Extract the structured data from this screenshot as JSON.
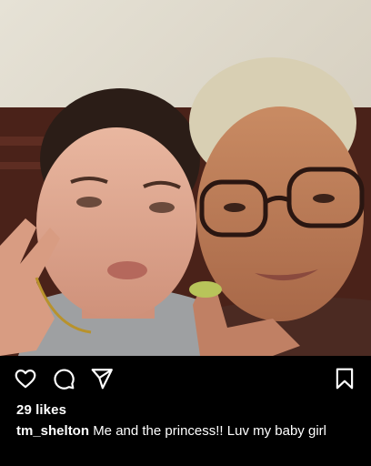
{
  "post": {
    "photo_alt": "Selfie photo",
    "likes_text": "29 likes",
    "username": "tm_shelton",
    "caption": "Me and the princess!! Luv my baby girl"
  },
  "actions": {
    "like_icon": "heart-icon",
    "comment_icon": "comment-bubble-icon",
    "share_icon": "paper-plane-icon",
    "save_icon": "bookmark-icon"
  },
  "colors": {
    "background": "#000000",
    "text": "#ffffff"
  }
}
